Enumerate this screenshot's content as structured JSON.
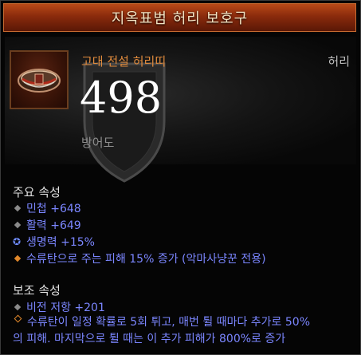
{
  "title": "지옥표범 허리 보호구",
  "item": {
    "rarity_type": "고대 전설 허리띠",
    "slot": "허리",
    "armor_value": "498",
    "armor_label": "방어도"
  },
  "primary": {
    "heading": "주요 속성",
    "stats": [
      {
        "text": "민첩 +648",
        "icon": "gray-diamond-icon"
      },
      {
        "text": "활력 +649",
        "icon": "gray-diamond-icon"
      },
      {
        "text": "생명력 +15%",
        "icon": "swirl-icon"
      },
      {
        "text": "수류탄으로 주는 피해 15% 증가 (악마사냥꾼 전용)",
        "icon": "orange-diamond-icon"
      }
    ]
  },
  "secondary": {
    "heading": "보조 속성",
    "stats": [
      {
        "text": "비전 저항 +201",
        "icon": "gray-diamond-icon"
      }
    ],
    "legendary_line1": "수류탄이 일정 확률로 5회 튀고, 매번 튈 때마다 추가로 50%",
    "legendary_line2": "의 피해. 마지막으로 튈 때는 이 추가 피해가 800%로 증가"
  },
  "colors": {
    "title_bar": "#8a2a0c",
    "item_name": "#e08a3c",
    "magic_stat": "#7b86ff"
  }
}
